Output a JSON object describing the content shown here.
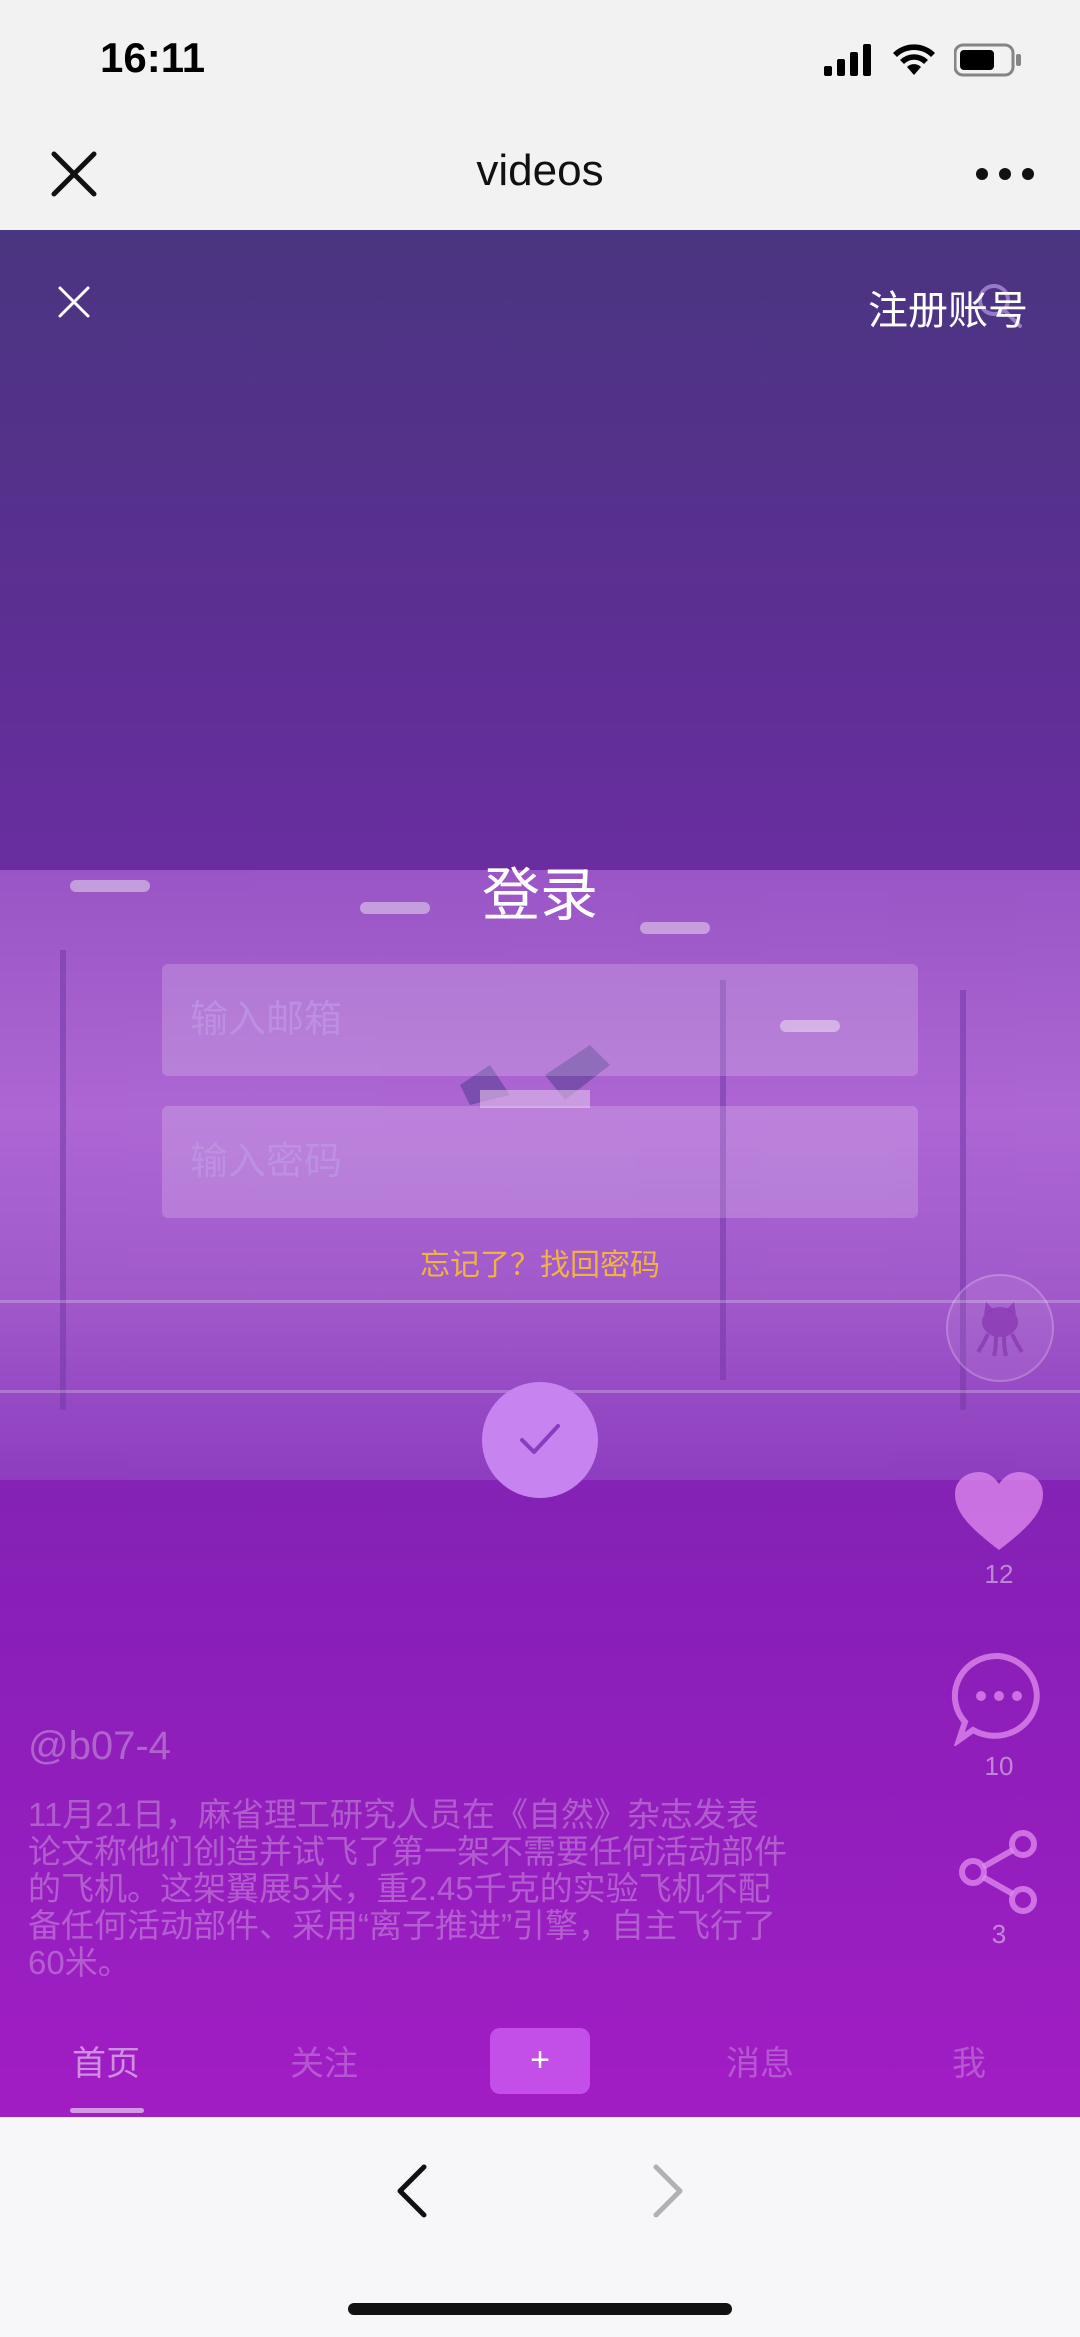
{
  "status_bar": {
    "time": "16:11"
  },
  "nav": {
    "title": "videos"
  },
  "overlay": {
    "register_label": "注册账号",
    "login_title": "登录",
    "email_placeholder": "输入邮箱",
    "password_placeholder": "输入密码",
    "forgot_label": "忘记了？找回密码"
  },
  "video": {
    "author": "@b07-4",
    "description": "11月21日，麻省理工研究人员在《自然》杂志发表论文称他们创造并试飞了第一架不需要任何活动部件的飞机。这架翼展5米，重2.45千克的实验飞机不配备任何活动部件、采用“离子推进”引擎，自主飞行了60米。",
    "likes": "12",
    "comments": "10",
    "shares": "3"
  },
  "tabs": {
    "home": "首页",
    "follow": "关注",
    "add": "+",
    "messages": "消息",
    "me": "我"
  },
  "colors": {
    "accent_gold": "#f0b43e",
    "tab_add": "#c34fe8",
    "submit": "#c784f0"
  }
}
